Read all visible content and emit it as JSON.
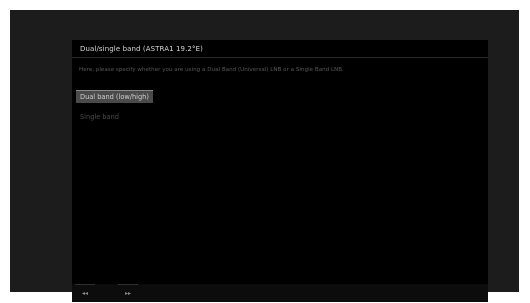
{
  "dialog": {
    "title": "Dual/single band (ASTRA1 19.2°E)",
    "instruction": "Here, please specify whether you are using a Dual Band (Universal) LNB or a Single Band LNB."
  },
  "options": [
    {
      "label": "Dual band (low/high)",
      "selected": true
    },
    {
      "label": "Single band",
      "selected": false
    }
  ],
  "footer": {
    "back_symbol": "◂◂",
    "next_symbol": "▸▸"
  }
}
